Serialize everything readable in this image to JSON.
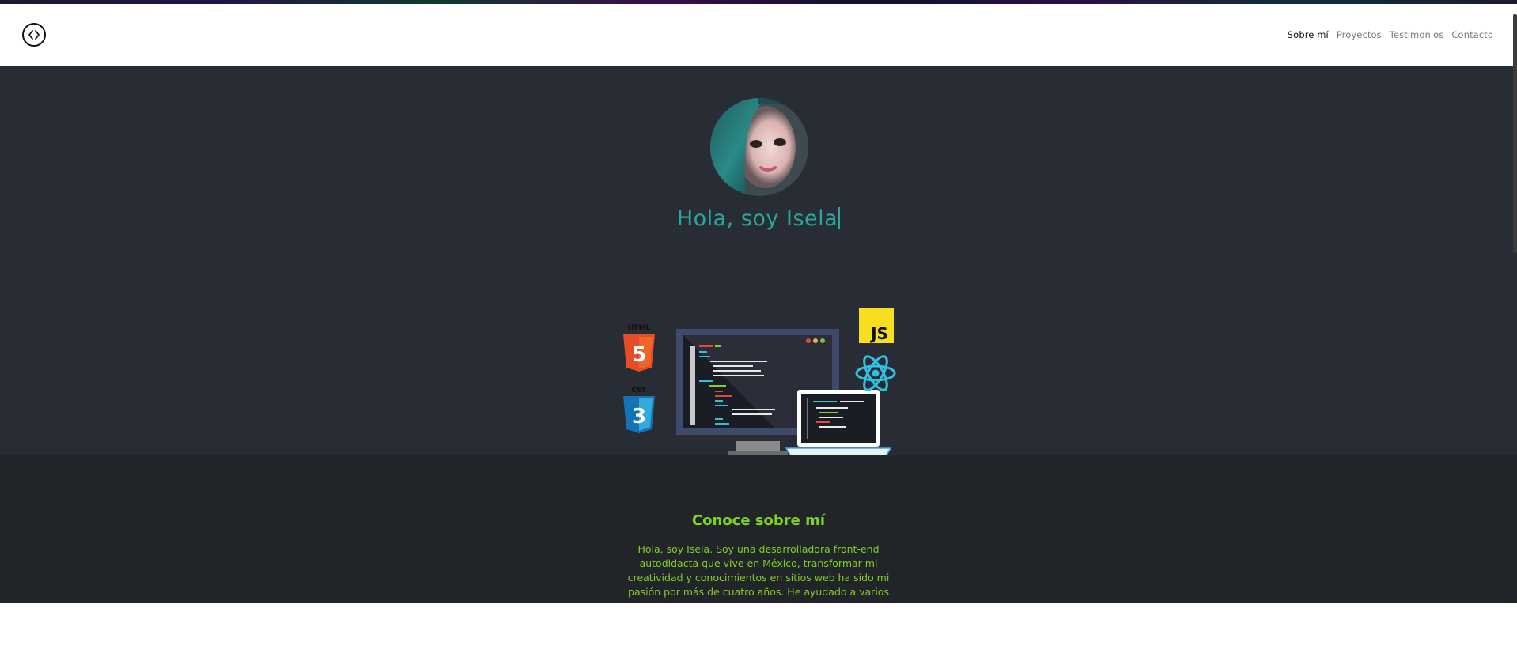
{
  "nav": {
    "items": [
      {
        "label": "Sobre mí",
        "active": true
      },
      {
        "label": "Proyectos",
        "active": false
      },
      {
        "label": "Testimonios",
        "active": false
      },
      {
        "label": "Contacto",
        "active": false
      }
    ],
    "logo_icon": "code-brackets-icon"
  },
  "hero": {
    "greeting": "Hola, soy Isela",
    "accent_color": "#2aa8a0",
    "illustration": {
      "html_label": "HTML",
      "html_badge": "5",
      "css_label": "CSS",
      "css_badge": "3",
      "js_label": "JS"
    }
  },
  "about": {
    "title": "Conoce sobre mí",
    "body": "Hola, soy Isela. Soy una desarrolladora front-end autodidacta que vive en México, transformar mi creatividad y conocimientos en sitios web ha sido mi pasión por más de cuatro años. He ayudado a varios",
    "text_color": "#7ed321"
  },
  "colors": {
    "hero_bg": "#282c34",
    "about_bg": "#212428"
  }
}
